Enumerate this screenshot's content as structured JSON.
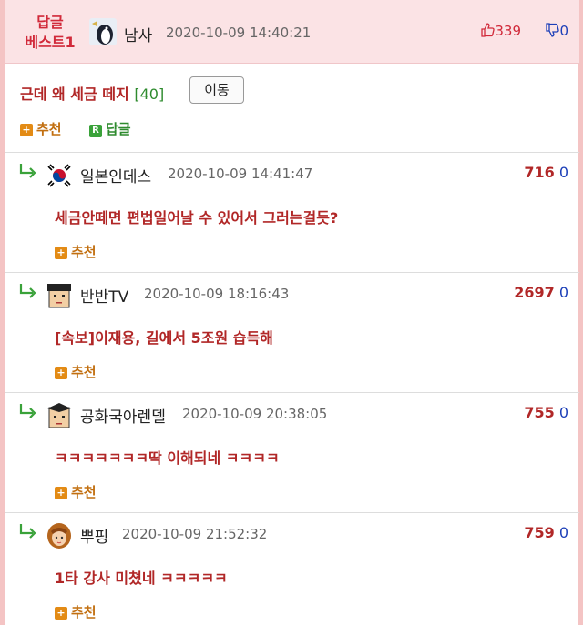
{
  "header": {
    "badge_line1": "답글",
    "badge_line2": "베스트1",
    "author": "남사",
    "date": "2020-10-09 14:40:21",
    "upvotes": "339",
    "downvotes": "0"
  },
  "post": {
    "title": "근데 왜 세금 떼지",
    "comment_count": "[40]",
    "move_button": "이동",
    "recommend_label": "추천",
    "reply_label": "답글",
    "reply_icon": "R"
  },
  "comments": [
    {
      "author": "일본인데스",
      "date": "2020-10-09 14:41:47",
      "up": "716",
      "down": "0",
      "body": "세금안떼면 편법일어날 수 있어서 그러는걸듯?",
      "recommend": "추천"
    },
    {
      "author": "반반TV",
      "date": "2020-10-09 18:16:43",
      "up": "2697",
      "down": "0",
      "body": "[속보]이재용, 길에서 5조원 습득해",
      "recommend": "추천"
    },
    {
      "author": "공화국아렌델",
      "date": "2020-10-09 20:38:05",
      "up": "755",
      "down": "0",
      "body": "ㅋㅋㅋㅋㅋㅋㅋ딱 이해되네 ㅋㅋㅋㅋ",
      "recommend": "추천"
    },
    {
      "author": "뿌핑",
      "date": "2020-10-09 21:52:32",
      "up": "759",
      "down": "0",
      "body": "1타 강사 미쳤네 ㅋㅋㅋㅋㅋ",
      "recommend": "추천"
    }
  ],
  "icons": {
    "reply_arrow": "reply-arrow-icon",
    "thumb_up": "thumbs-up-icon",
    "thumb_down": "thumbs-down-icon"
  },
  "colors": {
    "accent_red": "#b12727",
    "header_bg": "#fbe3e5",
    "green": "#2e8b2e",
    "orange": "#e38b15",
    "blue": "#1c3fb8"
  }
}
